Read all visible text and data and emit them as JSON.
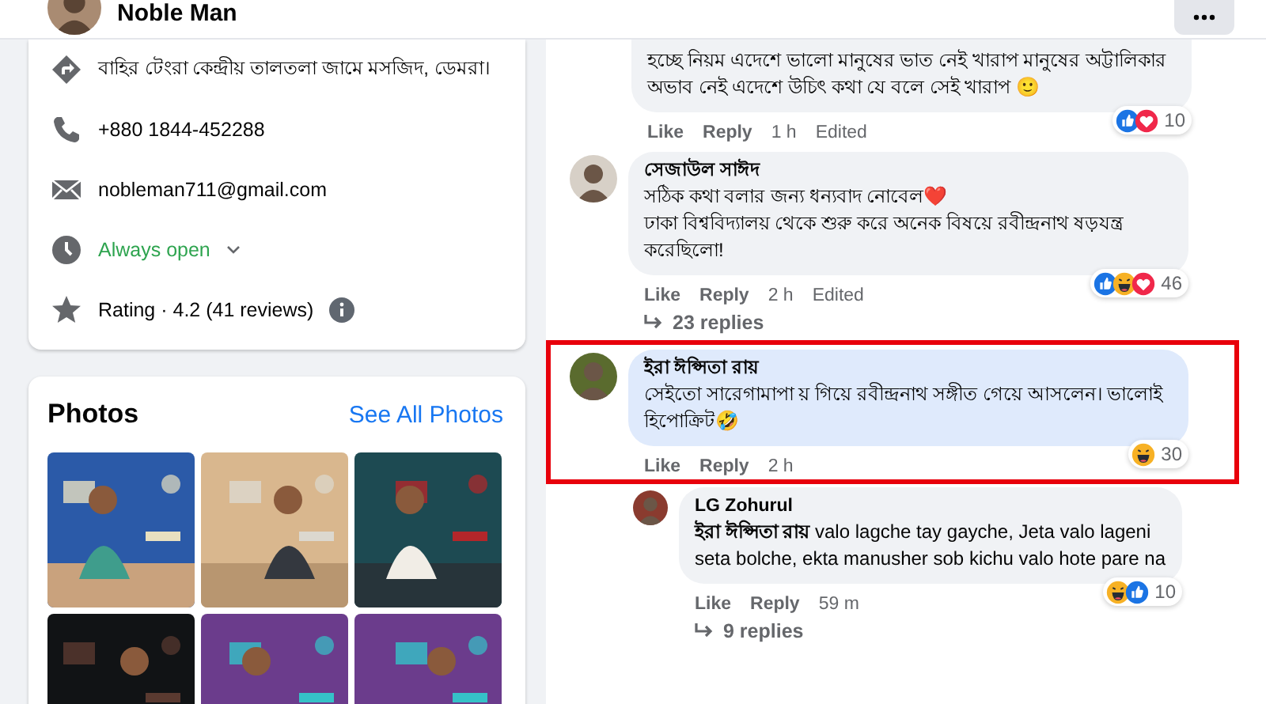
{
  "header": {
    "name": "Noble Man"
  },
  "intro": {
    "items": [
      {
        "kind": "address",
        "text": "বাহির টেংরা কেন্দ্রীয় তালতলা জামে মসজিদ, ডেমরা।"
      },
      {
        "kind": "phone",
        "text": "+880 1844-452288"
      },
      {
        "kind": "email",
        "text": "nobleman711@gmail.com"
      },
      {
        "kind": "hours",
        "text": "Always open"
      },
      {
        "kind": "rating",
        "text": "Rating · 4.2 (41 reviews)"
      }
    ]
  },
  "photos": {
    "title": "Photos",
    "link": "See All Photos"
  },
  "comments": [
    {
      "kind": "comment",
      "text": "হচ্ছে নিয়ম এদেশে ভালো মানুষের ভাত নেই খারাপ মানুষের অট্টালিকার অভাব নেই এদেশে উচিৎ কথা যে বলে সেই খারাপ 🙂",
      "boxed": false,
      "reactions": {
        "types": [
          {
            "kind": "like"
          },
          {
            "kind": "love"
          }
        ],
        "count": "10"
      },
      "actions": [
        {
          "kind": "button",
          "label": "Like"
        },
        {
          "kind": "button",
          "label": "Reply"
        },
        {
          "kind": "meta",
          "label": "1 h"
        },
        {
          "kind": "meta",
          "label": "Edited"
        }
      ]
    },
    {
      "kind": "comment",
      "author": "সেজাউল সাঈদ",
      "text": "সঠিক কথা বলার জন্য ধন্যবাদ নোবেল❤️\nঢাকা বিশ্ববিদ্যালয় থেকে শুরু করে অনেক বিষয়ে রবীন্দ্রনাথ ষড়যন্ত্র করেছিলো!",
      "boxed": false,
      "reactions": {
        "types": [
          {
            "kind": "like"
          },
          {
            "kind": "haha"
          },
          {
            "kind": "love"
          }
        ],
        "count": "46"
      },
      "actions": [
        {
          "kind": "button",
          "label": "Like"
        },
        {
          "kind": "button",
          "label": "Reply"
        },
        {
          "kind": "meta",
          "label": "2 h"
        },
        {
          "kind": "meta",
          "label": "Edited"
        }
      ],
      "replies": "23 replies"
    },
    {
      "kind": "comment",
      "author": "ইরা ঈপ্সিতা রায়",
      "text": "সেইতো সারেগামাপা য় গিয়ে রবীন্দ্রনাথ সঙ্গীত গেয়ে আসলেন। ভালোই হিপোক্রিট🤣",
      "boxed": true,
      "reactions": {
        "types": [
          {
            "kind": "haha"
          }
        ],
        "count": "30"
      },
      "actions": [
        {
          "kind": "button",
          "label": "Like"
        },
        {
          "kind": "button",
          "label": "Reply"
        },
        {
          "kind": "meta",
          "label": "2 h"
        }
      ]
    },
    {
      "kind": "reply",
      "author": "LG Zohurul",
      "text": "**ইরা ঈপ্সিতা রায়** valo lagche tay gayche, Jeta valo lageni seta bolche, ekta manusher sob kichu valo hote pare na",
      "boxed": false,
      "reactions": {
        "types": [
          {
            "kind": "haha"
          },
          {
            "kind": "like"
          }
        ],
        "count": "10"
      },
      "actions": [
        {
          "kind": "button",
          "label": "Like"
        },
        {
          "kind": "button",
          "label": "Reply"
        },
        {
          "kind": "meta",
          "label": "59 m"
        }
      ],
      "replies": "9 replies"
    }
  ]
}
